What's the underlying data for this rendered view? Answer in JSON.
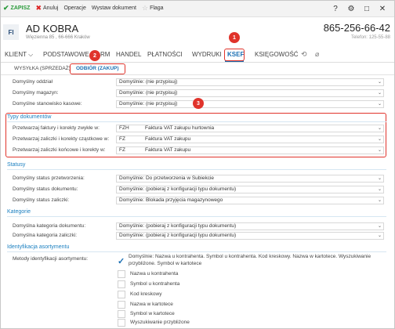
{
  "toolbar": {
    "save": "ZAPISZ",
    "cancel": "Anuluj",
    "operations": "Operacje",
    "print": "Wystaw dokument",
    "flag": "Flaga"
  },
  "header": {
    "avatar": "FI",
    "name": "AD KOBRA",
    "address": "Więzienna 85 , 66-666 Kraków",
    "phone": "865-256-66-42",
    "tel": "Telefon: 125-55-88"
  },
  "nav": {
    "tabs": [
      "KLIENT",
      "PODSTAWOWE",
      "RM",
      "HANDEL",
      "PŁATNOŚCI",
      "WYDRUKI",
      "KSEF",
      "KSIĘGOWOŚĆ"
    ]
  },
  "subtabs": {
    "sales": "WYSYŁKA (SPRZEDAŻ)",
    "purchase": "ODBIÓR (ZAKUP)"
  },
  "badges": [
    "1",
    "2",
    "3"
  ],
  "general": {
    "rows": [
      {
        "label": "Domyślny oddział",
        "value": "Domyślnie: (nie przypisuj)"
      },
      {
        "label": "Domyślny magazyn:",
        "value": "Domyślnie: (nie przypisuj)"
      },
      {
        "label": "Domyślne stanowisko kasowe:",
        "value": "Domyślnie: (nie przypisuj)"
      }
    ]
  },
  "doc_types": {
    "title": "Typy dokumentów",
    "rows": [
      {
        "label": "Przetwarzaj faktury i korekty zwykłe w:",
        "code": "FZH",
        "value": "Faktura VAT zakupu hurtownia"
      },
      {
        "label": "Przetwarzaj zaliczki i korekty cząstkowe w:",
        "code": "FZ",
        "value": "Faktura VAT zakupu"
      },
      {
        "label": "Przetwarzaj zaliczki końcowe i korekty w:",
        "code": "FZ",
        "value": "Faktura VAT zakupu"
      }
    ]
  },
  "statuses": {
    "title": "Statusy",
    "rows": [
      {
        "label": "Domyślny status przetworzenia:",
        "value": "Domyślnie: Do przetworzenia w Subiekcie"
      },
      {
        "label": "Domyślny status dokumentu:",
        "value": "Domyślnie: (pobieraj z konfiguracji typu dokumentu)"
      },
      {
        "label": "Domyślny status zaliczki:",
        "value": "Domyślnie: Blokada przyjęcia magazynowego"
      }
    ]
  },
  "categories": {
    "title": "Kategorie",
    "rows": [
      {
        "label": "Domyślna kategoria dokumentu:",
        "value": "Domyślnie: (pobieraj z konfiguracji typu dokumentu)"
      },
      {
        "label": "Domyślna kategoria zaliczki:",
        "value": "Domyślnie: (pobieraj z konfiguracji typu dokumentu)"
      }
    ]
  },
  "identification": {
    "title": "Identyfikacja asortymentu",
    "label": "Metody identyfikacji asortymentu:",
    "default_text": "Domyślnie: Nazwa u kontrahenta. Symbol u kontrahenta. Kod kreskowy. Nazwa w kartotece. Wyszukiwanie przybliżone. Symbol w kartotece",
    "options": [
      "Nazwa u kontrahenta",
      "Symbol u kontrahenta",
      "Kod kreskowy",
      "Nazwa w kartotece",
      "Symbol w kartotece",
      "Wyszukiwanie przybliżone"
    ]
  }
}
